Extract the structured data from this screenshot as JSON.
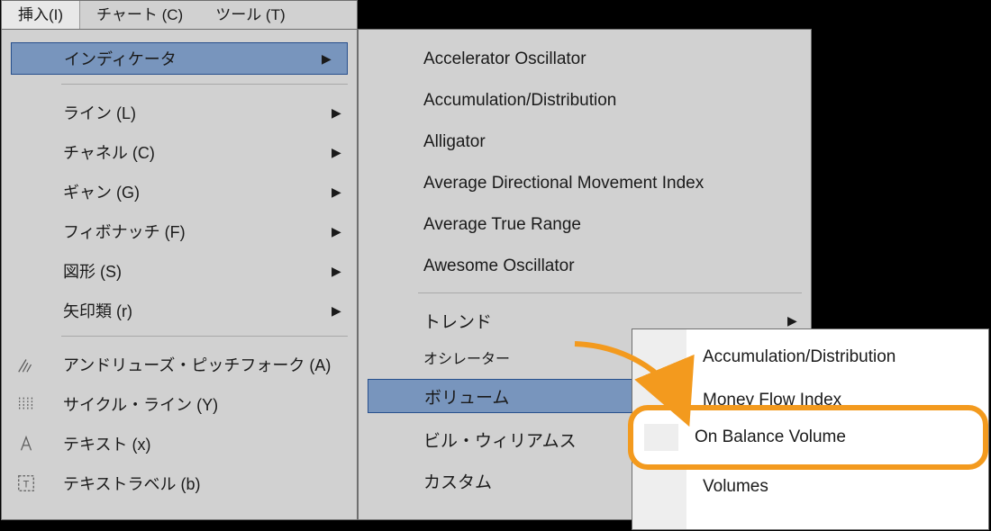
{
  "menubar": {
    "tabs": [
      {
        "label": "挿入(I)",
        "active": true
      },
      {
        "label": "チャート (C)",
        "active": false
      },
      {
        "label": "ツール (T)",
        "active": false
      }
    ]
  },
  "menu1": {
    "items": [
      {
        "label": "インディケータ",
        "hasSub": true,
        "selected": true
      },
      {
        "label": "ライン (L)",
        "hasSub": true
      },
      {
        "label": "チャネル (C)",
        "hasSub": true
      },
      {
        "label": "ギャン (G)",
        "hasSub": true
      },
      {
        "label": "フィボナッチ (F)",
        "hasSub": true
      },
      {
        "label": "図形 (S)",
        "hasSub": true
      },
      {
        "label": "矢印類 (r)",
        "hasSub": true
      },
      {
        "label": "アンドリューズ・ピッチフォーク (A)",
        "icon": "pitchfork-icon"
      },
      {
        "label": "サイクル・ライン (Y)",
        "icon": "cycle-lines-icon"
      },
      {
        "label": "テキスト (x)",
        "icon": "text-icon"
      },
      {
        "label": "テキストラベル (b)",
        "icon": "text-label-icon"
      }
    ]
  },
  "menu2": {
    "items": [
      {
        "label": "Accelerator Oscillator"
      },
      {
        "label": "Accumulation/Distribution"
      },
      {
        "label": "Alligator"
      },
      {
        "label": "Average Directional Movement Index"
      },
      {
        "label": "Average True Range"
      },
      {
        "label": "Awesome Oscillator"
      },
      {
        "label": "トレンド",
        "hasSub": true
      },
      {
        "label": "オシレーター",
        "small": true
      },
      {
        "label": "ボリューム",
        "selected": true
      },
      {
        "label": "ビル・ウィリアムス"
      },
      {
        "label": "カスタム",
        "hasSub": true
      }
    ]
  },
  "menu3": {
    "items": [
      {
        "label": "Accumulation/Distribution"
      },
      {
        "label": "Money Flow Index"
      },
      {
        "label": "On Balance Volume"
      },
      {
        "label": "Volumes"
      }
    ]
  },
  "highlight": {
    "label": "On Balance Volume"
  }
}
